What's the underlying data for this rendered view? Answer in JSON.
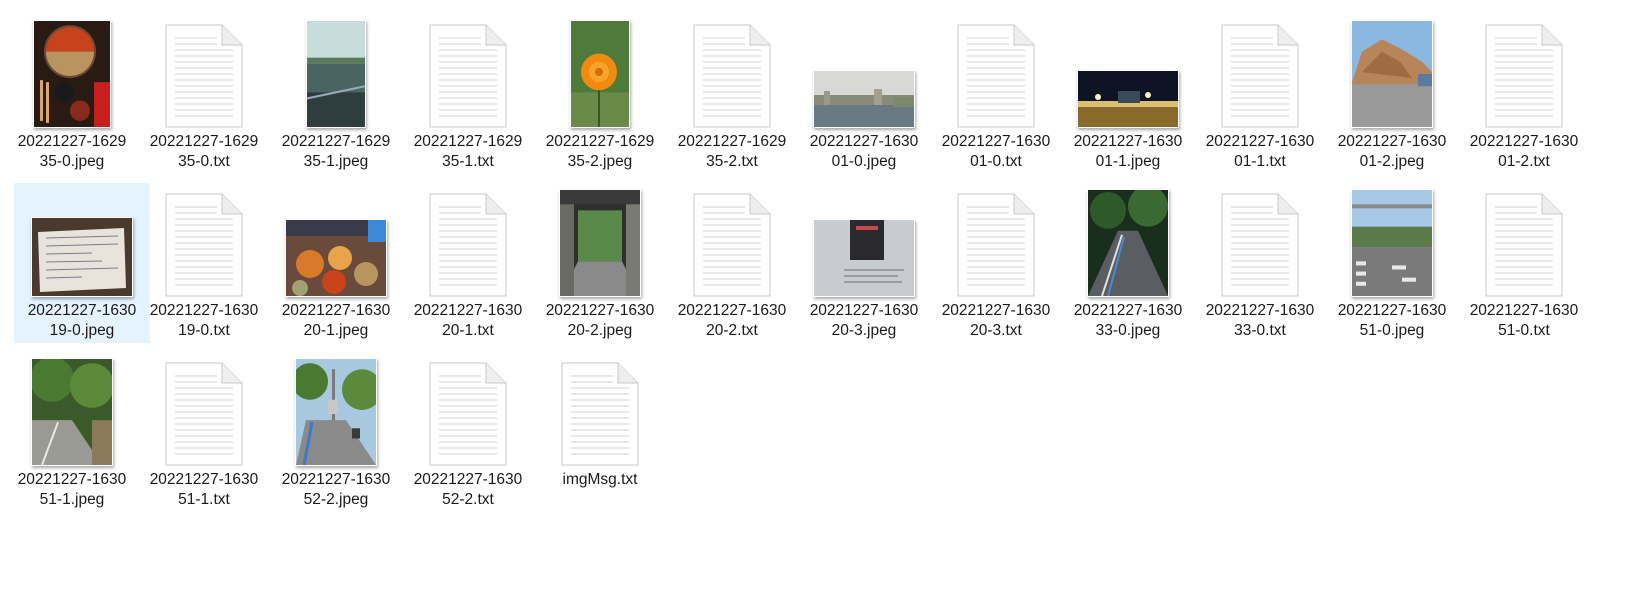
{
  "window": {
    "view": "Large icons"
  },
  "files": [
    {
      "line1": "20221227-1629",
      "line2": "35-0.jpeg",
      "type": "image",
      "thumbnail": "hotpot-photo",
      "selected": false
    },
    {
      "line1": "20221227-1629",
      "line2": "35-0.txt",
      "type": "text",
      "thumbnail": "text-document-icon",
      "selected": false
    },
    {
      "line1": "20221227-1629",
      "line2": "35-1.jpeg",
      "type": "image",
      "thumbnail": "waterfront-photo",
      "selected": false
    },
    {
      "line1": "20221227-1629",
      "line2": "35-1.txt",
      "type": "text",
      "thumbnail": "text-document-icon",
      "selected": false
    },
    {
      "line1": "20221227-1629",
      "line2": "35-2.jpeg",
      "type": "image",
      "thumbnail": "orange-flower-photo",
      "selected": false
    },
    {
      "line1": "20221227-1629",
      "line2": "35-2.txt",
      "type": "text",
      "thumbnail": "text-document-icon",
      "selected": false
    },
    {
      "line1": "20221227-1630",
      "line2": "01-0.jpeg",
      "type": "image",
      "thumbnail": "harbor-photo",
      "selected": false
    },
    {
      "line1": "20221227-1630",
      "line2": "01-0.txt",
      "type": "text",
      "thumbnail": "text-document-icon",
      "selected": false
    },
    {
      "line1": "20221227-1630",
      "line2": "01-1.jpeg",
      "type": "image",
      "thumbnail": "night-street-photo",
      "selected": false
    },
    {
      "line1": "20221227-1630",
      "line2": "01-1.txt",
      "type": "text",
      "thumbnail": "text-document-icon",
      "selected": false
    },
    {
      "line1": "20221227-1630",
      "line2": "01-2.jpeg",
      "type": "image",
      "thumbnail": "cliff-photo",
      "selected": false
    },
    {
      "line1": "20221227-1630",
      "line2": "01-2.txt",
      "type": "text",
      "thumbnail": "text-document-icon",
      "selected": false
    },
    {
      "line1": "20221227-1630",
      "line2": "19-0.jpeg",
      "type": "image",
      "thumbnail": "receipt-photo",
      "selected": true
    },
    {
      "line1": "20221227-1630",
      "line2": "19-0.txt",
      "type": "text",
      "thumbnail": "text-document-icon",
      "selected": false
    },
    {
      "line1": "20221227-1630",
      "line2": "20-1.jpeg",
      "type": "image",
      "thumbnail": "dinner-table-photo",
      "selected": false
    },
    {
      "line1": "20221227-1630",
      "line2": "20-1.txt",
      "type": "text",
      "thumbnail": "text-document-icon",
      "selected": false
    },
    {
      "line1": "20221227-1630",
      "line2": "20-2.jpeg",
      "type": "image",
      "thumbnail": "corridor-photo",
      "selected": false
    },
    {
      "line1": "20221227-1630",
      "line2": "20-2.txt",
      "type": "text",
      "thumbnail": "text-document-icon",
      "selected": false
    },
    {
      "line1": "20221227-1630",
      "line2": "20-3.jpeg",
      "type": "image",
      "thumbnail": "screen-photo",
      "selected": false
    },
    {
      "line1": "20221227-1630",
      "line2": "20-3.txt",
      "type": "text",
      "thumbnail": "text-document-icon",
      "selected": false
    },
    {
      "line1": "20221227-1630",
      "line2": "33-0.jpeg",
      "type": "image",
      "thumbnail": "night-road-photo",
      "selected": false
    },
    {
      "line1": "20221227-1630",
      "line2": "33-0.txt",
      "type": "text",
      "thumbnail": "text-document-icon",
      "selected": false
    },
    {
      "line1": "20221227-1630",
      "line2": "51-0.jpeg",
      "type": "image",
      "thumbnail": "crosswalk-photo",
      "selected": false
    },
    {
      "line1": "20221227-1630",
      "line2": "51-0.txt",
      "type": "text",
      "thumbnail": "text-document-icon",
      "selected": false
    },
    {
      "line1": "20221227-1630",
      "line2": "51-1.jpeg",
      "type": "image",
      "thumbnail": "tree-lined-path-photo",
      "selected": false
    },
    {
      "line1": "20221227-1630",
      "line2": "51-1.txt",
      "type": "text",
      "thumbnail": "text-document-icon",
      "selected": false
    },
    {
      "line1": "20221227-1630",
      "line2": "52-2.jpeg",
      "type": "image",
      "thumbnail": "sidewalk-photo",
      "selected": false
    },
    {
      "line1": "20221227-1630",
      "line2": "52-2.txt",
      "type": "text",
      "thumbnail": "text-document-icon",
      "selected": false
    },
    {
      "line1": "imgMsg.txt",
      "line2": "",
      "type": "text",
      "thumbnail": "text-document-icon",
      "selected": false
    }
  ]
}
